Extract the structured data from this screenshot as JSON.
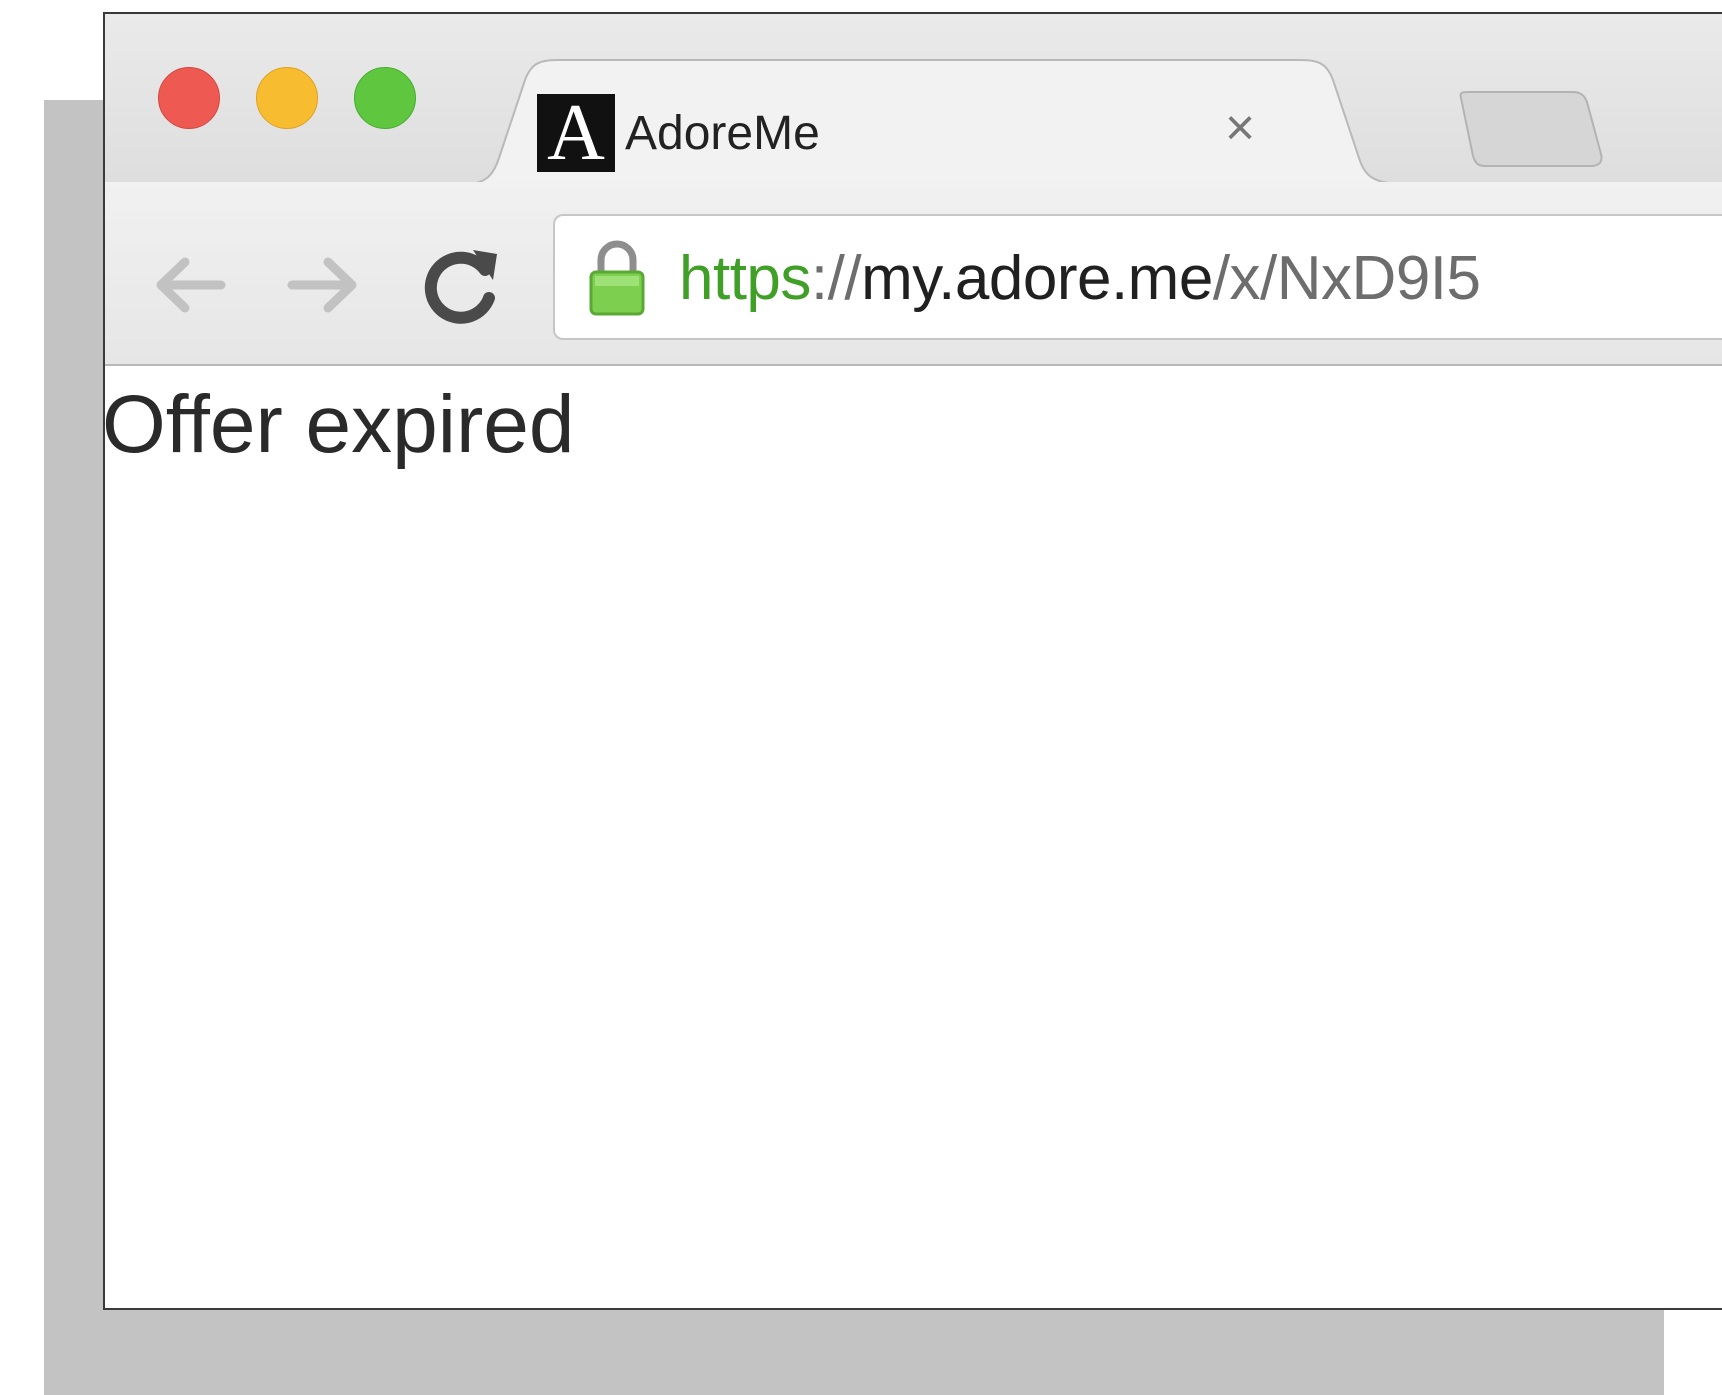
{
  "browser": {
    "tab": {
      "favicon_letter": "A",
      "title": "AdoreMe",
      "close_glyph": "×"
    },
    "toolbar": {
      "back_icon": "back-arrow-icon",
      "forward_icon": "forward-arrow-icon",
      "reload_icon": "reload-icon"
    },
    "address_bar": {
      "secure": true,
      "url_scheme": "https",
      "url_separator": "://",
      "url_host": "my.adore.me",
      "url_path": "/x/NxD9I5"
    }
  },
  "page": {
    "message": "Offer expired"
  },
  "colors": {
    "close_button": "#ee5a52",
    "minimize_button": "#f8bc31",
    "maximize_button": "#5ec63f",
    "secure_scheme": "#3f9f26",
    "lock": "#7dcf4f"
  }
}
